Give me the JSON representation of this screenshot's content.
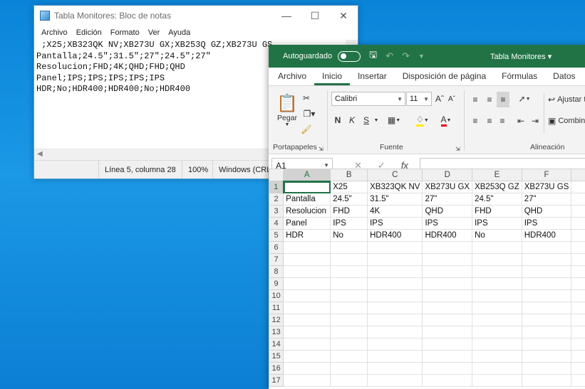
{
  "notepad": {
    "title": "Tabla Monitores: Bloc de notas",
    "menu": [
      "Archivo",
      "Edición",
      "Formato",
      "Ver",
      "Ayuda"
    ],
    "lines": [
      " ;X25;XB323QK NV;XB273U GX;XB253Q GZ;XB273U GS",
      "Pantalla;24.5\";31.5\";27\";24.5\";27\"",
      "Resolucion;FHD;4K;QHD;FHD;QHD",
      "Panel;IPS;IPS;IPS;IPS;IPS",
      "HDR;No;HDR400;HDR400;No;HDR400"
    ],
    "status": {
      "position": "Línea 5, columna 28",
      "zoom": "100%",
      "encoding": "Windows (CRLF)"
    }
  },
  "excel": {
    "autosave_label": "Autoguardado",
    "doc_title": "Tabla Monitores",
    "tabs": [
      "Archivo",
      "Inicio",
      "Insertar",
      "Disposición de página",
      "Fórmulas",
      "Datos"
    ],
    "active_tab": "Inicio",
    "ribbon": {
      "paste_label": "Pegar",
      "clipboard_group": "Portapapeles",
      "font_name": "Calibri",
      "font_size": "11",
      "font_group": "Fuente",
      "bold": "N",
      "italic": "K",
      "underline": "S",
      "align_group": "Alineación",
      "wrap_label": "Ajustar t",
      "merge_label": "Combin"
    },
    "name_box": "A1",
    "fx": "fx",
    "columns": [
      "A",
      "B",
      "C",
      "D",
      "E",
      "F"
    ],
    "rows": [
      [
        "",
        "X25",
        "XB323QK NV",
        "XB273U GX",
        "XB253Q GZ",
        "XB273U GS"
      ],
      [
        "Pantalla",
        "24.5\"",
        "31.5\"",
        "27\"",
        "24.5\"",
        "27\""
      ],
      [
        "Resolucion",
        "FHD",
        "4K",
        "QHD",
        "FHD",
        "QHD"
      ],
      [
        "Panel",
        "IPS",
        "IPS",
        "IPS",
        "IPS",
        "IPS"
      ],
      [
        "HDR",
        "No",
        "HDR400",
        "HDR400",
        "No",
        "HDR400"
      ],
      [
        "",
        "",
        "",
        "",
        "",
        ""
      ],
      [
        "",
        "",
        "",
        "",
        "",
        ""
      ],
      [
        "",
        "",
        "",
        "",
        "",
        ""
      ],
      [
        "",
        "",
        "",
        "",
        "",
        ""
      ],
      [
        "",
        "",
        "",
        "",
        "",
        ""
      ],
      [
        "",
        "",
        "",
        "",
        "",
        ""
      ],
      [
        "",
        "",
        "",
        "",
        "",
        ""
      ],
      [
        "",
        "",
        "",
        "",
        "",
        ""
      ],
      [
        "",
        "",
        "",
        "",
        "",
        ""
      ],
      [
        "",
        "",
        "",
        "",
        "",
        ""
      ],
      [
        "",
        "",
        "",
        "",
        "",
        ""
      ],
      [
        "",
        "",
        "",
        "",
        "",
        ""
      ]
    ],
    "accent_color": "#217346"
  }
}
